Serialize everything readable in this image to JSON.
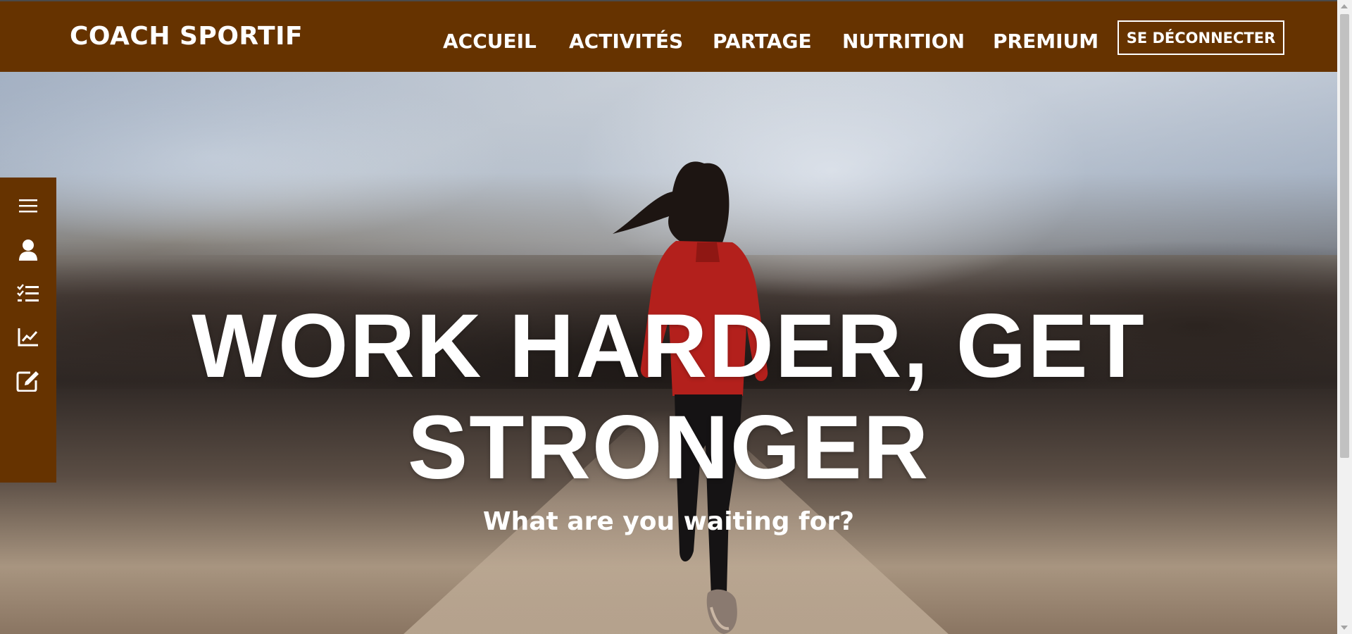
{
  "header": {
    "brand": "COACH SPORTIF",
    "nav": [
      {
        "label": "ACCUEIL"
      },
      {
        "label": "ACTIVITÉS"
      },
      {
        "label": "PARTAGE"
      },
      {
        "label": "NUTRITION"
      },
      {
        "label": "PREMIUM"
      }
    ],
    "logout_label": "SE DÉCONNECTER",
    "background_color": "#663300"
  },
  "sidebar": {
    "background_color": "#663300",
    "items": [
      {
        "icon": "menu-icon"
      },
      {
        "icon": "user-icon"
      },
      {
        "icon": "checklist-icon"
      },
      {
        "icon": "chart-line-icon"
      },
      {
        "icon": "edit-icon"
      }
    ]
  },
  "hero": {
    "headline_line1": "WORK HARDER, GET",
    "headline_line2": "STRONGER",
    "subheadline": "What are you waiting for?",
    "background": "runner-on-road-photo"
  }
}
